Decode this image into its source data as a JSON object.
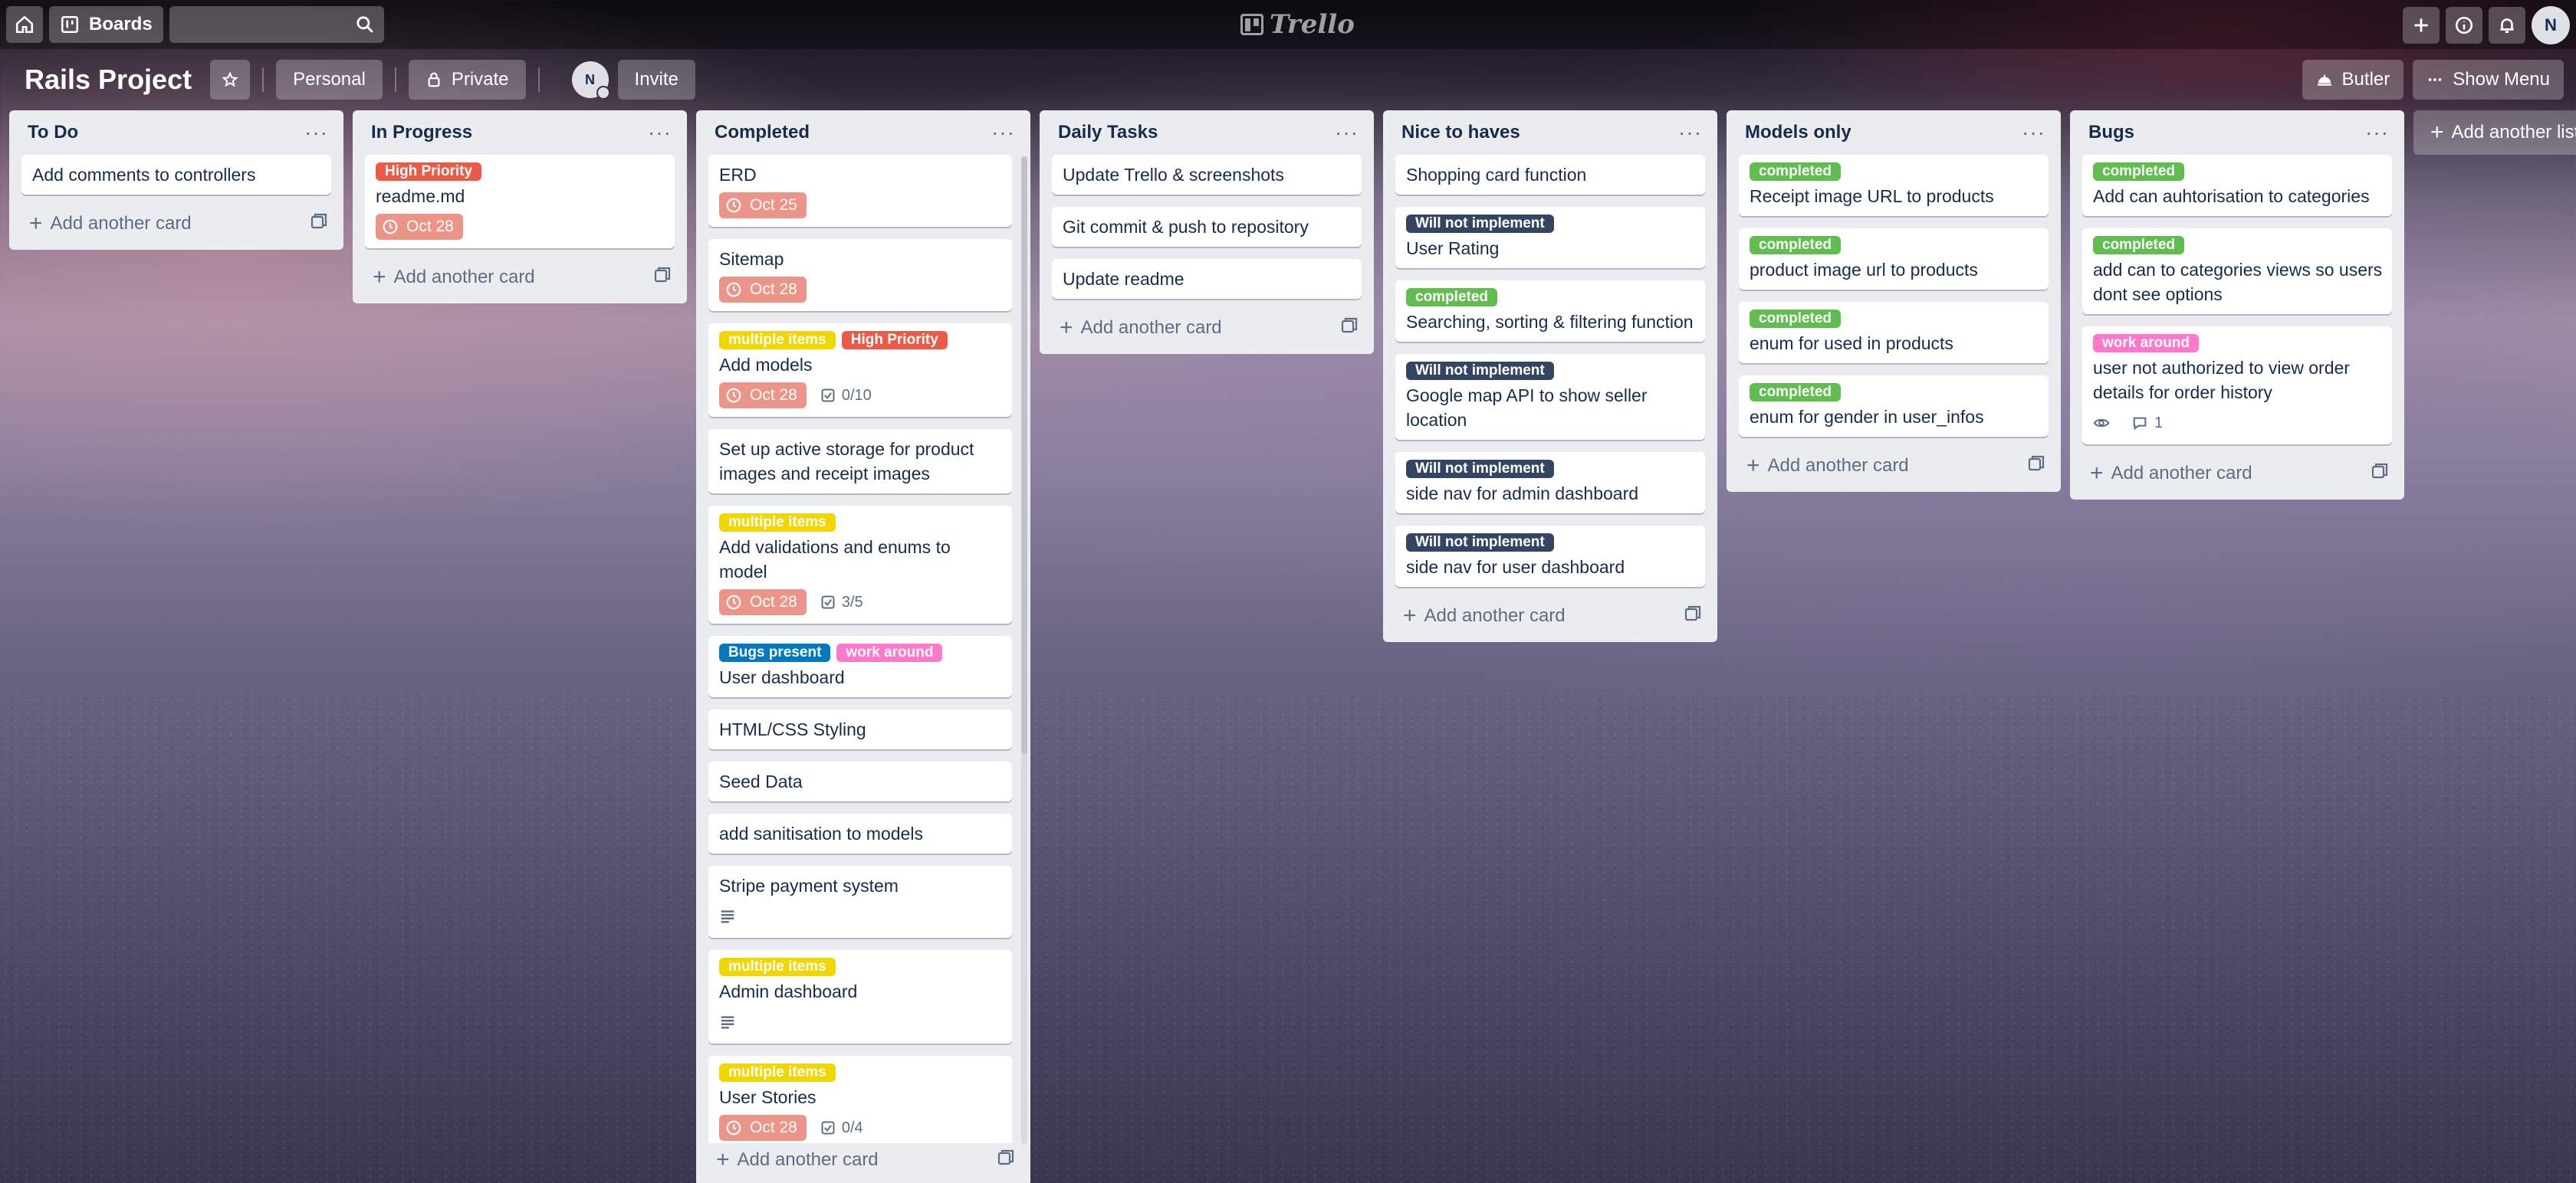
{
  "topbar": {
    "boards_label": "Boards",
    "logo_text": "Trello",
    "avatar_initial": "N"
  },
  "board": {
    "title": "Rails Project",
    "team_label": "Personal",
    "visibility_label": "Private",
    "member_initial": "N",
    "invite_label": "Invite",
    "butler_label": "Butler",
    "show_menu_label": "Show Menu",
    "add_list_label": "Add another list"
  },
  "add_card_label": "Add another card",
  "label_colors": {
    "High Priority": "#eb5a46",
    "multiple items": "#f2d600",
    "Bugs present": "#0079bf",
    "work around": "#ff78cb",
    "Will not implement": "#344563",
    "completed": "#61bd4f"
  },
  "lists": [
    {
      "title": "To Do",
      "cards": [
        {
          "title": "Add comments to controllers"
        }
      ]
    },
    {
      "title": "In Progress",
      "cards": [
        {
          "labels": [
            "High Priority"
          ],
          "title": "readme.md",
          "due": "Oct 28"
        }
      ]
    },
    {
      "title": "Completed",
      "cards": [
        {
          "title": "ERD",
          "due": "Oct 25"
        },
        {
          "title": "Sitemap",
          "due": "Oct 28"
        },
        {
          "labels": [
            "multiple items",
            "High Priority"
          ],
          "title": "Add models",
          "due": "Oct 28",
          "checklist": "0/10"
        },
        {
          "title": "Set up active storage for product images and receipt images"
        },
        {
          "labels": [
            "multiple items"
          ],
          "title": "Add validations and enums to model",
          "due": "Oct 28",
          "checklist": "3/5"
        },
        {
          "labels": [
            "Bugs present",
            "work around"
          ],
          "title": "User dashboard"
        },
        {
          "title": "HTML/CSS Styling"
        },
        {
          "title": "Seed Data"
        },
        {
          "title": "add sanitisation to models"
        },
        {
          "title": "Stripe payment system",
          "description": true
        },
        {
          "labels": [
            "multiple items"
          ],
          "title": "Admin dashboard",
          "description": true
        },
        {
          "labels": [
            "multiple items"
          ],
          "title": "User Stories",
          "due": "Oct 28",
          "checklist": "0/4"
        }
      ]
    },
    {
      "title": "Daily Tasks",
      "cards": [
        {
          "title": "Update Trello & screenshots"
        },
        {
          "title": "Git commit & push to repository"
        },
        {
          "title": "Update readme"
        }
      ]
    },
    {
      "title": "Nice to haves",
      "cards": [
        {
          "title": "Shopping card function"
        },
        {
          "labels": [
            "Will not implement"
          ],
          "title": "User Rating"
        },
        {
          "labels": [
            "completed"
          ],
          "title": "Searching, sorting & filtering function"
        },
        {
          "labels": [
            "Will not implement"
          ],
          "title": "Google map API to show seller location"
        },
        {
          "labels": [
            "Will not implement"
          ],
          "title": "side nav for admin dashboard"
        },
        {
          "labels": [
            "Will not implement"
          ],
          "title": "side nav for user dashboard"
        }
      ]
    },
    {
      "title": "Models only",
      "cards": [
        {
          "labels": [
            "completed"
          ],
          "title": "Receipt image URL to products"
        },
        {
          "labels": [
            "completed"
          ],
          "title": "product image url to products"
        },
        {
          "labels": [
            "completed"
          ],
          "title": "enum for used in products"
        },
        {
          "labels": [
            "completed"
          ],
          "title": "enum for gender in user_infos"
        }
      ]
    },
    {
      "title": "Bugs",
      "cards": [
        {
          "labels": [
            "completed"
          ],
          "title": "Add can auhtorisation to categories"
        },
        {
          "labels": [
            "completed"
          ],
          "title": "add can to categories views so users dont see options"
        },
        {
          "labels": [
            "work around"
          ],
          "title": "user not authorized to view order details for order history",
          "watching": true,
          "comments": "1"
        }
      ]
    }
  ]
}
